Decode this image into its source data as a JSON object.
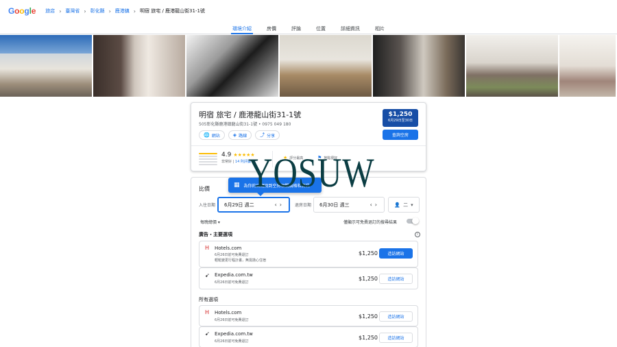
{
  "header": {
    "logo": "Google",
    "breadcrumbs": [
      "旅店",
      "臺灣省",
      "彰化縣",
      "鹿港鎮",
      "明宿 旅宅 / 鹿港龍山街31-1號"
    ]
  },
  "tabs": [
    "環境介紹",
    "房價",
    "評論",
    "位置",
    "詳細資訊",
    "相片"
  ],
  "active_tab": "環境介紹",
  "hotel": {
    "name": "明宿 旅宅 / 鹿港龍山街31-1號",
    "address": "505彰化縣鹿港鎮龍山街31-1號 • 0975 049 180",
    "actions": [
      "網站",
      "路線",
      "分享"
    ],
    "price": "$1,250",
    "price_dates": "6月29日至30日",
    "check_availability": "查詢空房",
    "rating": "4.9",
    "stars": "★★★★★",
    "rating_label": "非常好",
    "reviews_link": "14 則評論",
    "features": [
      "評分最高",
      "地點很好"
    ]
  },
  "booking": {
    "title": "比價",
    "tooltip": "為你的日期找到空房相關價格和資訊",
    "checkin_label": "入住日期",
    "checkin_value": "6月29日 週二",
    "checkout_label": "退房日期",
    "checkout_value": "6月30日 週三",
    "guests": "二",
    "nightly_label": "每晚總價",
    "free_cancel_label": "僅顯示可免費退訂的搜尋結果",
    "sponsored_label": "廣告・主要選項",
    "all_options_label": "所有選項",
    "sponsored": [
      {
        "name": "Hotels.com",
        "notes": [
          "6月26日前可免費退訂",
          "輕鬆變更行程計畫，無需擔心住宿"
        ],
        "price": "$1,250",
        "cta": "造訪網站"
      },
      {
        "name": "Expedia.com.tw",
        "notes": [
          "6月26日前可免費退訂"
        ],
        "price": "$1,250",
        "cta": "造訪網站"
      }
    ],
    "all": [
      {
        "name": "Hotels.com",
        "notes": [
          "6月26日前可免費退訂"
        ],
        "price": "$1,250",
        "cta": "造訪網站"
      },
      {
        "name": "Expedia.com.tw",
        "notes": [
          "6月26日前可免費退訂"
        ],
        "price": "$1,250",
        "cta": "造訪網站"
      }
    ]
  },
  "watermark": "YOSUW"
}
